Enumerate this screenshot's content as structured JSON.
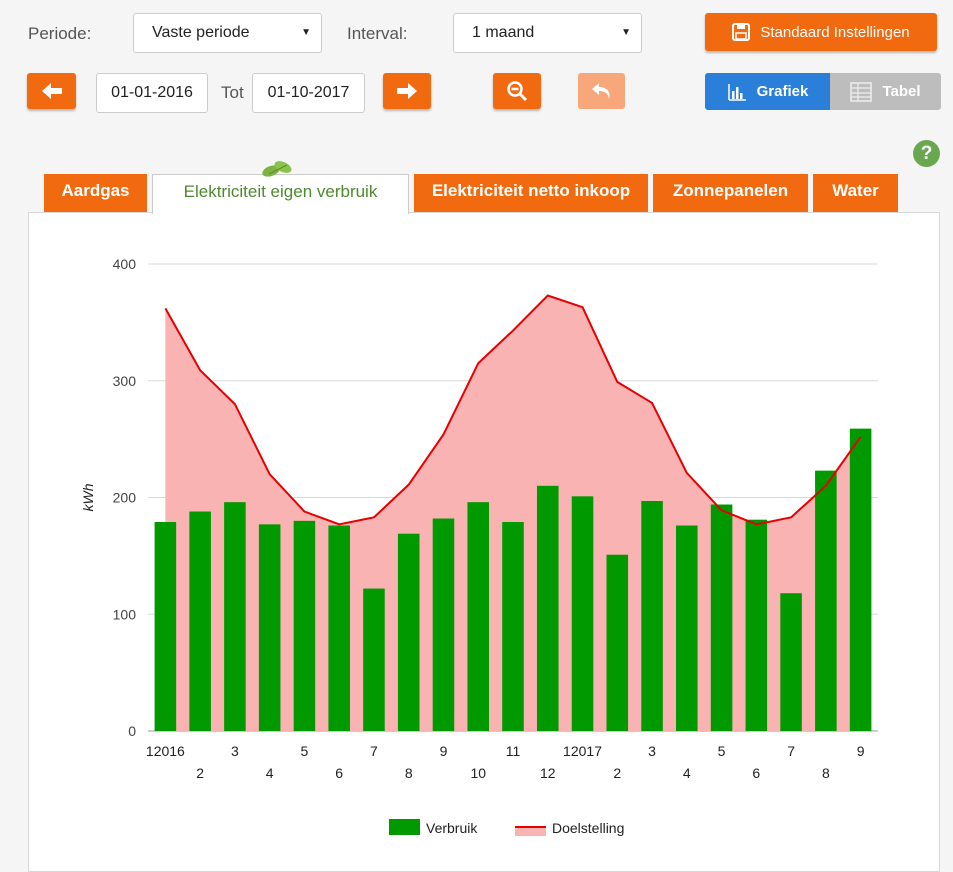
{
  "controls": {
    "periode_label": "Periode:",
    "periode_value": "Vaste periode",
    "interval_label": "Interval:",
    "interval_value": "1 maand",
    "standaard_label": "Standaard Instellingen",
    "start_date": "01-01-2016",
    "tot_label": "Tot",
    "end_date": "01-10-2017",
    "grafiek_label": "Grafiek",
    "tabel_label": "Tabel"
  },
  "tabs": [
    {
      "label": "Aardgas",
      "active": false
    },
    {
      "label": "Elektriciteit eigen verbruik",
      "active": true
    },
    {
      "label": "Elektriciteit netto inkoop",
      "active": false
    },
    {
      "label": "Zonnepanelen",
      "active": false
    },
    {
      "label": "Water",
      "active": false
    }
  ],
  "help_symbol": "?",
  "colors": {
    "accent": "#f26a10",
    "toggle_active": "#2a7fd8",
    "toggle_inactive": "#bdbdbd",
    "bar": "#009900",
    "line": "#e60000",
    "area": "#f9b3b3",
    "active_tab_text": "#4d8a2e"
  },
  "chart_data": {
    "type": "bar",
    "ylabel": "kWh",
    "ylim": [
      0,
      400
    ],
    "yticks": [
      0,
      100,
      200,
      300,
      400
    ],
    "categories": [
      "12016",
      "2",
      "3",
      "4",
      "5",
      "6",
      "7",
      "8",
      "9",
      "10",
      "11",
      "12",
      "12017",
      "2",
      "3",
      "4",
      "5",
      "6",
      "7",
      "8",
      "9"
    ],
    "series": [
      {
        "name": "Verbruik",
        "type": "bar",
        "values": [
          179,
          188,
          196,
          177,
          180,
          176,
          122,
          169,
          182,
          196,
          179,
          210,
          201,
          151,
          197,
          176,
          194,
          181,
          118,
          223,
          259
        ]
      },
      {
        "name": "Doelstelling",
        "type": "area-line",
        "values": [
          362,
          309,
          280,
          220,
          188,
          177,
          183,
          211,
          254,
          315,
          343,
          373,
          363,
          299,
          281,
          221,
          189,
          177,
          183,
          210,
          252
        ]
      }
    ],
    "grid": true,
    "legend": "bottom-center"
  }
}
